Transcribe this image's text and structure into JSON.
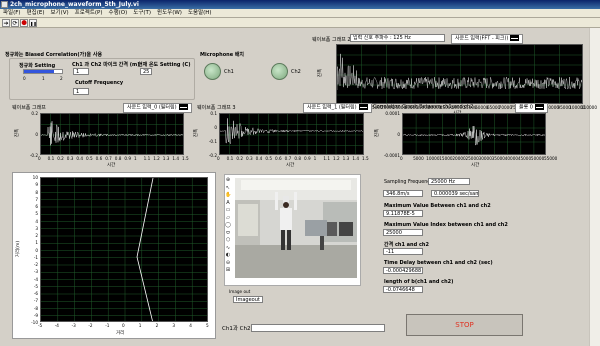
{
  "window": {
    "title": "2ch_microphone_waveform_5th_July.vi"
  },
  "menu": [
    "파일(F)",
    "편집(E)",
    "보기(V)",
    "프로젝트(P)",
    "수행(O)",
    "도구(T)",
    "윈도우(W)",
    "도움말(H)"
  ],
  "toolbar": {
    "run": "➔",
    "run_cont": "⟳",
    "abort": "⬤",
    "pause": "❚❚"
  },
  "biased": {
    "title": "정규화는 Biased Correlation(가)을 사용",
    "norm_label": "정규화 Setting",
    "slider_ticks": [
      "0",
      "1",
      "2"
    ],
    "dist_label": "Ch1 과 Ch2 마이크 간격 (m)",
    "dist_value": "1",
    "temp_label": "현재 온도 Setting (C)",
    "temp_value": "25",
    "cutoff_label": "Cutoff Frequency",
    "cutoff_value": "1"
  },
  "mic": {
    "title": "Microphone 배치",
    "ch1": "Ch1",
    "ch2": "Ch2"
  },
  "fft": {
    "title": "웨이브폼 그래프 2",
    "sample_rate": "입력 신호 주파수 : 125 Hz",
    "legend": "사운드 입력(FFT - 피크))",
    "ylabel": "진폭",
    "xlabel": "시간",
    "xticks": [
      "0",
      "5000",
      "10000",
      "15000",
      "20000",
      "25000",
      "30000",
      "35000",
      "40000",
      "45000",
      "50000",
      "55000",
      "60000",
      "65000",
      "70000",
      "75000",
      "80000",
      "85000",
      "90000",
      "95000",
      "100000",
      "110000"
    ]
  },
  "wave1": {
    "title": "웨이브폼 그래프",
    "legend": "사운드 입력_0 (필터링)",
    "ylabel": "진폭",
    "xlabel": "시간",
    "yticks": [
      "0.2",
      "0",
      "-0.2"
    ],
    "xticks": [
      "0",
      "0.1",
      "0.2",
      "0.3",
      "0.4",
      "0.5",
      "0.6",
      "0.7",
      "0.8",
      "0.9",
      "1",
      "1.1",
      "1.2",
      "1.3",
      "1.4",
      "1.5"
    ]
  },
  "wave3": {
    "title": "웨이브폼 그래프 3",
    "legend": "사운드 입력_1 (필터링)",
    "ylabel": "진폭",
    "xlabel": "시간",
    "yticks": [
      "0.1",
      "0",
      "-0.1",
      "-0.2"
    ],
    "xticks": [
      "0",
      "0.1",
      "0.2",
      "0.3",
      "0.4",
      "0.5",
      "0.6",
      "0.7",
      "0.8",
      "0.9",
      "1",
      "1.1",
      "1.2",
      "1.3",
      "1.4",
      "1.5"
    ]
  },
  "corr": {
    "title": "Correlation Graph Between ch1 and ch2",
    "legend": "플롯 0",
    "ylabel": "진폭",
    "xlabel": "시간",
    "yticks": [
      "0.0001",
      "0",
      "-0.0001"
    ],
    "xticks": [
      "0",
      "5000",
      "10000",
      "15000",
      "20000",
      "25000",
      "30000",
      "35000",
      "40000",
      "45000",
      "50000",
      "55000"
    ]
  },
  "xy": {
    "yticks": [
      "10",
      "9",
      "8",
      "7",
      "6",
      "5",
      "4",
      "3",
      "2",
      "1",
      "0",
      "-1",
      "-2",
      "-3",
      "-4",
      "-5",
      "-6",
      "-7",
      "-8",
      "-9",
      "-10"
    ],
    "xticks": [
      "-5",
      "-4",
      "-3",
      "-2",
      "-1",
      "0",
      "1",
      "2",
      "3",
      "4",
      "5"
    ],
    "ylabel": "거리(m)",
    "xlabel": "거리"
  },
  "camera": {
    "label": "Image out",
    "value": "Imageout"
  },
  "results": {
    "sampling_label": "Sampling Frequency",
    "sampling_value": "25000 Hz",
    "speed": "346.8m/s",
    "sample_time": "0.000039 sec/sample",
    "max_val_label": "Maximum Value Between ch1 and ch2",
    "max_val": "9.11878E-5",
    "max_idx_label": "Maximum Value Index between ch1 and ch2",
    "max_idx": "25000",
    "gap_label": "간격 ch1 and ch2",
    "gap": "-11",
    "delay_label": "Time Delay between ch1 and ch2 (sec)",
    "delay": "-0.000429688",
    "length_label": "length of b(ch1 and ch2)",
    "length": "-0.0746648"
  },
  "ch_between": {
    "label": "Ch1과 Ch2 "
  },
  "stop": {
    "label": "STOP"
  },
  "colors": {
    "stop_text": "#e03020",
    "graph_bg": "#000000",
    "plot_line": "#ffffff",
    "panel": "#d4d0c8",
    "titlebar": "#0a246a"
  }
}
